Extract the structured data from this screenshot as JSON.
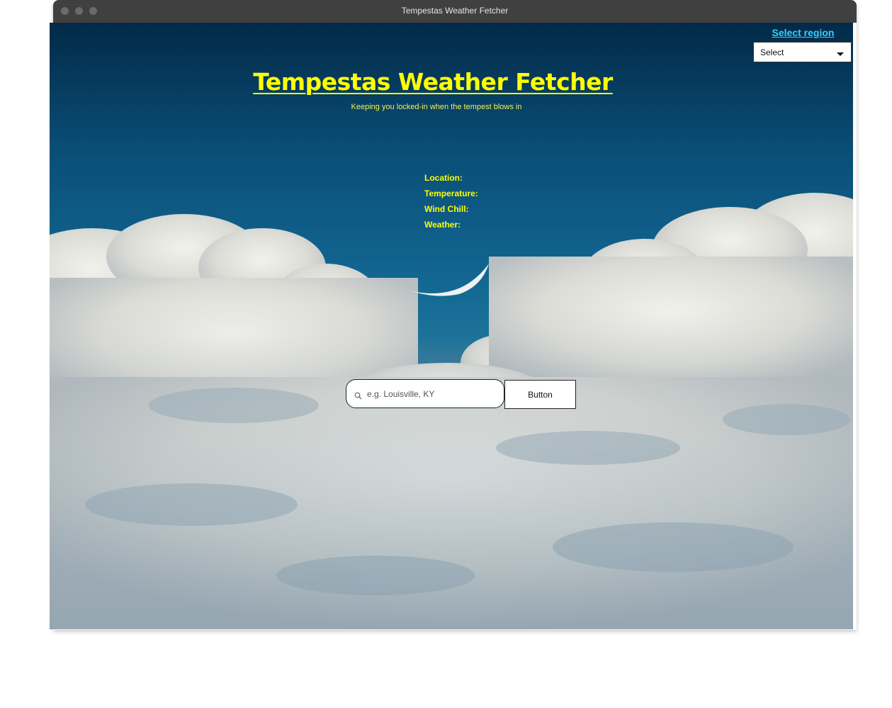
{
  "window": {
    "title": "Tempestas Weather Fetcher"
  },
  "region": {
    "link_label": "Select region",
    "select_value": "Select"
  },
  "header": {
    "title": "Tempestas Weather Fetcher",
    "subtitle": "Keeping you locked-in when the tempest blows in"
  },
  "weather_info": {
    "location_label": "Location:",
    "temperature_label": "Temperature:",
    "wind_chill_label": "Wind Chill:",
    "weather_label": "Weather:"
  },
  "search": {
    "placeholder": "e.g. Louisville, KY",
    "value": "",
    "button_label": "Button"
  },
  "colors": {
    "title_yellow": "#ffff00",
    "link_cyan": "#35d0ff",
    "titlebar": "#404040"
  }
}
